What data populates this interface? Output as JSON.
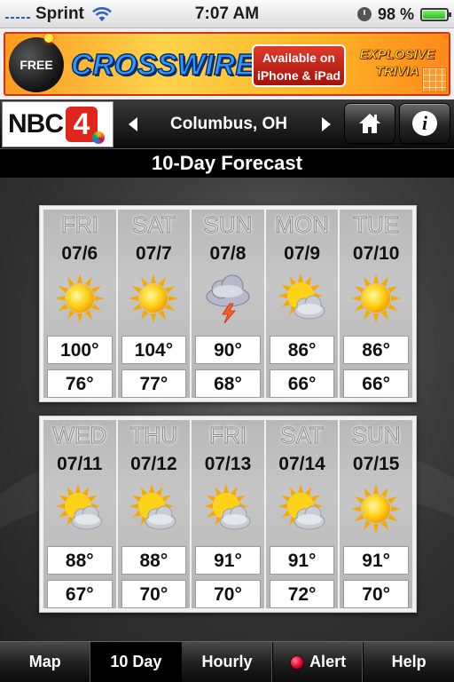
{
  "status_bar": {
    "carrier": "Sprint",
    "time": "7:07 AM",
    "battery_pct": "98 %",
    "battery_level": 0.98
  },
  "ad": {
    "free_label": "FREE",
    "title": "CROSSWIRE",
    "availability_line1": "Available on",
    "availability_line2": "iPhone & iPad",
    "tagline_line1": "EXPLOSIVE",
    "tagline_line2": "TRIVIA"
  },
  "nav": {
    "station_name": "NBC",
    "station_number": "4",
    "location": "Columbus, OH",
    "prev_icon": "triangle-left-icon",
    "next_icon": "triangle-right-icon",
    "home_icon": "home-icon",
    "info_label": "i"
  },
  "page": {
    "title": "10-Day Forecast"
  },
  "forecast": {
    "rows": [
      [
        {
          "day": "FRI",
          "date": "07/6",
          "icon": "sunny",
          "high": "100°",
          "low": "76°"
        },
        {
          "day": "SAT",
          "date": "07/7",
          "icon": "sunny",
          "high": "104°",
          "low": "77°"
        },
        {
          "day": "SUN",
          "date": "07/8",
          "icon": "thunderstorm",
          "high": "90°",
          "low": "68°"
        },
        {
          "day": "MON",
          "date": "07/9",
          "icon": "partly-cloudy",
          "high": "86°",
          "low": "66°"
        },
        {
          "day": "TUE",
          "date": "07/10",
          "icon": "sunny",
          "high": "86°",
          "low": "66°"
        }
      ],
      [
        {
          "day": "WED",
          "date": "07/11",
          "icon": "partly-cloudy",
          "high": "88°",
          "low": "67°"
        },
        {
          "day": "THU",
          "date": "07/12",
          "icon": "partly-cloudy",
          "high": "88°",
          "low": "70°"
        },
        {
          "day": "FRI",
          "date": "07/13",
          "icon": "partly-cloudy",
          "high": "91°",
          "low": "70°"
        },
        {
          "day": "SAT",
          "date": "07/14",
          "icon": "partly-cloudy",
          "high": "91°",
          "low": "72°"
        },
        {
          "day": "SUN",
          "date": "07/15",
          "icon": "sunny",
          "high": "91°",
          "low": "70°"
        }
      ]
    ]
  },
  "tabs": [
    {
      "label": "Map",
      "active": false,
      "alert": false
    },
    {
      "label": "10 Day",
      "active": true,
      "alert": false
    },
    {
      "label": "Hourly",
      "active": false,
      "alert": false
    },
    {
      "label": "Alert",
      "active": false,
      "alert": true
    },
    {
      "label": "Help",
      "active": false,
      "alert": false
    }
  ],
  "colors": {
    "alert_red": "#d5002a",
    "nbc_red": "#e0261c",
    "sun_yellow": "#ffd21a"
  }
}
